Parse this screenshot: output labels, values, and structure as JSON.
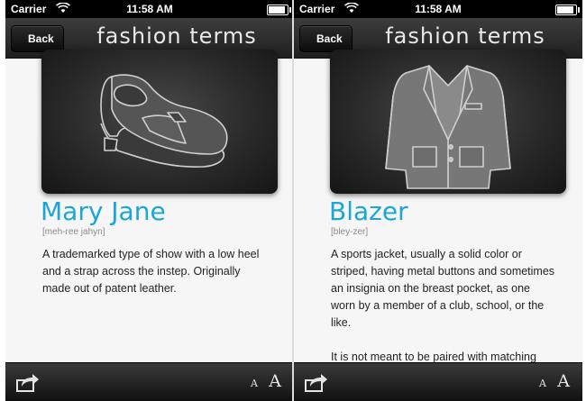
{
  "screens": [
    {
      "status": {
        "carrier": "Carrier",
        "time": "11:58 AM"
      },
      "nav": {
        "back_label": "Back",
        "title": "fashion terms"
      },
      "image_icon": "mary-jane-shoe-illustration",
      "term": "Mary Jane",
      "pronunciation": "[meh-ree jahyn]",
      "definition": [
        "A trademarked type of show with a low heel and a strap across the instep. Originally made out of patent leather."
      ],
      "toolbar": {
        "font_small": "A",
        "font_large": "A"
      }
    },
    {
      "status": {
        "carrier": "Carrier",
        "time": "11:58 AM"
      },
      "nav": {
        "back_label": "Back",
        "title": "fashion terms"
      },
      "image_icon": "blazer-jacket-illustration",
      "term": "Blazer",
      "pronunciation": "[bley-zer]",
      "definition": [
        "A sports jacket, usually a solid color or striped, having metal buttons and sometimes an insignia on the breast pocket, as one worn by a member of a club, school, or the like.",
        "It is not meant to be paired with matching pants or bottom."
      ],
      "toolbar": {
        "font_small": "A",
        "font_large": "A"
      }
    }
  ],
  "colors": {
    "accent": "#1ba6d6",
    "bar": "#2a2a2a"
  }
}
